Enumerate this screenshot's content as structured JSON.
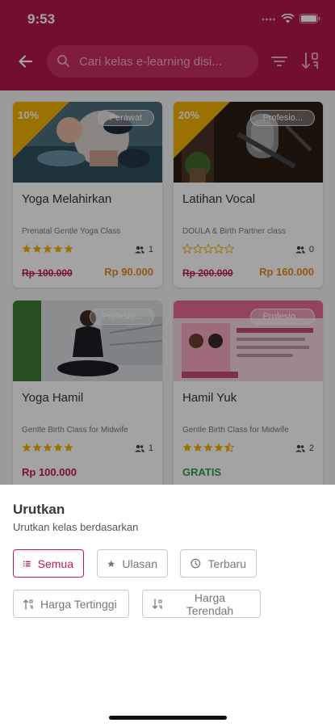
{
  "status_bar": {
    "time": "9:53"
  },
  "header": {
    "search_placeholder": "Cari kelas e-learning disi..."
  },
  "courses": [
    {
      "title": "Yoga Melahirkan",
      "subtitle": "Prenatal Gentle Yoga Class",
      "category": "Perawat",
      "discount": "10%",
      "rating": 5,
      "students": "1",
      "old_price": "Rp 100.000",
      "price": "Rp 90.000"
    },
    {
      "title": "Latihan Vocal",
      "subtitle": "DOULA & Birth Partner class",
      "category": "Profesio...",
      "discount": "20%",
      "rating": 0,
      "students": "0",
      "old_price": "Rp 200.000",
      "price": "Rp 160.000"
    },
    {
      "title": "Yoga Hamil",
      "subtitle": "Gentle Birth Class for Midwife",
      "category": "Profesio...",
      "rating": 5,
      "students": "1",
      "price": "Rp 100.000"
    },
    {
      "title": "Hamil Yuk",
      "subtitle": "Gentle Birth Class for Midwife",
      "category": "Profesio...",
      "rating": 4.5,
      "students": "2",
      "price": "GRATIS"
    }
  ],
  "sort_sheet": {
    "title": "Urutkan",
    "subtitle": "Urutkan kelas berdasarkan",
    "options": [
      {
        "label": "Semua",
        "icon": "list-icon",
        "active": true
      },
      {
        "label": "Ulasan",
        "icon": "star-icon",
        "active": false
      },
      {
        "label": "Terbaru",
        "icon": "clock-icon",
        "active": false
      },
      {
        "label": "Harga Tertinggi",
        "icon": "sort-asc-icon",
        "active": false
      },
      {
        "label": "Harga Terendah",
        "icon": "sort-desc-icon",
        "active": false
      }
    ]
  },
  "colors": {
    "primary": "#b3174c",
    "accent_pink": "#c2185b",
    "discount": "#f2b203",
    "price_orange": "#e6891c",
    "free_green": "#2f9d4f",
    "star": "#f2b203"
  }
}
